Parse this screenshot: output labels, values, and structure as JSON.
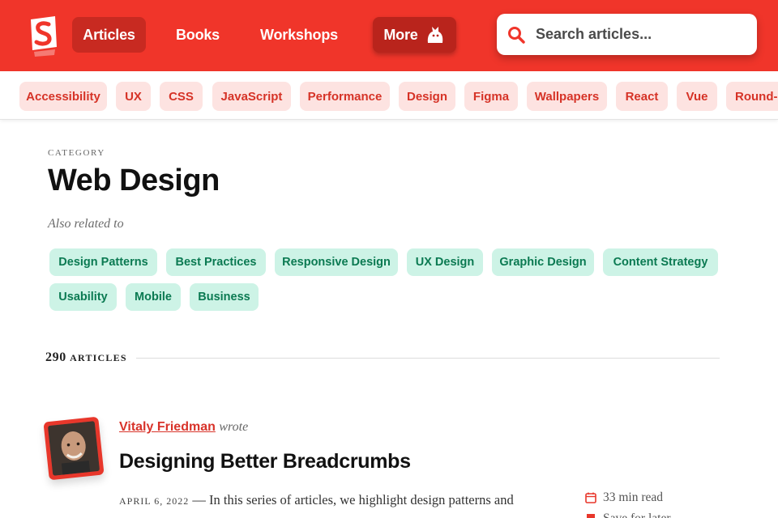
{
  "header": {
    "nav": [
      {
        "label": "Articles"
      },
      {
        "label": "Books"
      },
      {
        "label": "Workshops"
      },
      {
        "label": "More"
      }
    ],
    "search": {
      "placeholder": "Search articles..."
    }
  },
  "tags": [
    "Accessibility",
    "UX",
    "CSS",
    "JavaScript",
    "Performance",
    "Design",
    "Figma",
    "Wallpapers",
    "React",
    "Vue",
    "Round-Up"
  ],
  "category": {
    "label": "CATEGORY",
    "title": "Web Design",
    "related_label": "Also related to",
    "related": [
      "Design Patterns",
      "Best Practices",
      "Responsive Design",
      "UX Design",
      "Graphic Design",
      "Content Strategy",
      "Usability",
      "Mobile",
      "Business"
    ]
  },
  "count": {
    "number": "290",
    "word": "ARTICLES"
  },
  "article": {
    "author": "Vitaly Friedman",
    "wrote": "wrote",
    "title": "Designing Better Breadcrumbs",
    "date": "APRIL 6, 2022",
    "excerpt": " — In this series of articles, we highlight design patterns and techniques to design better interfaces. Here, you’ll find common rules and",
    "read_time": "33 min read",
    "second_meta": "Save for later"
  },
  "colors": {
    "brand": "#f0352a",
    "tag_bg": "#fde3e1",
    "related_bg": "#cdf3e6",
    "related_text": "#0b7a52"
  }
}
